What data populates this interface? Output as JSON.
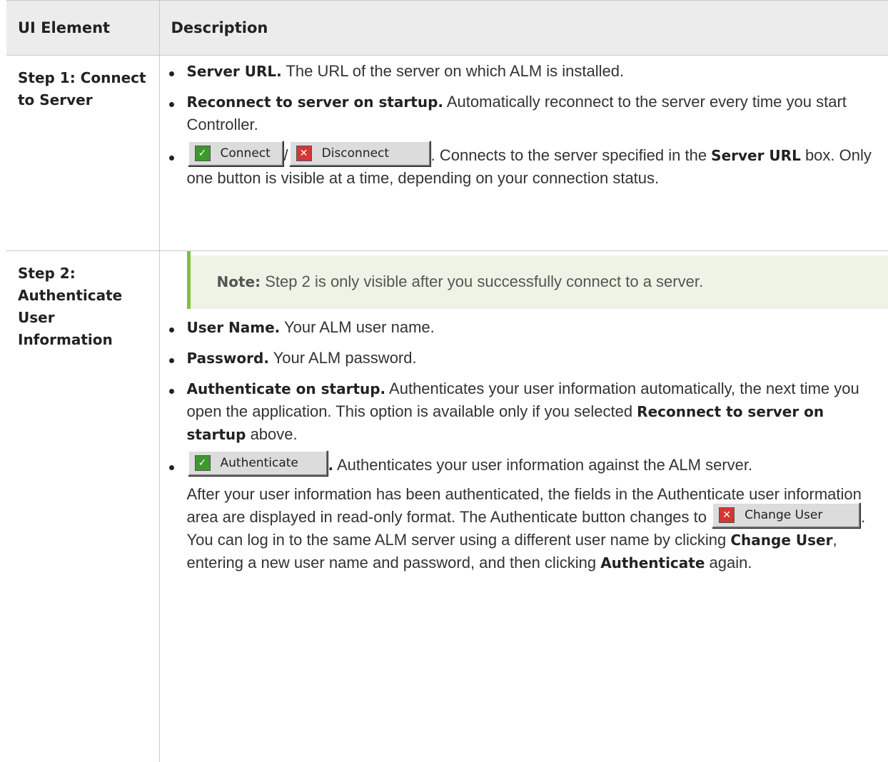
{
  "header": {
    "col1": "UI Element",
    "col2": "Description"
  },
  "step1": {
    "title": "Step 1: Connect to Server",
    "bullet1_label": "Server URL.",
    "bullet1_text": " The URL of the server on which ALM is installed.",
    "bullet2_label": "Reconnect to server on startup.",
    "bullet2_text": " Automatically reconnect to the server every time you start Controller.",
    "connect_button": "Connect",
    "separator": "/",
    "disconnect_button": "Disconnect",
    "bullet3_text_a": ". Connects to the server specified in the ",
    "bullet3_bold": "Server URL",
    "bullet3_text_b": " box. Only one button is visible at a time, depending on your connection status."
  },
  "step2": {
    "title": "Step 2: Authenticate User Information",
    "note_label": "Note:",
    "note_text": " Step 2 is only visible after you successfully connect to a server.",
    "bullet1_label": "User Name.",
    "bullet1_text": " Your ALM user name.",
    "bullet2_label": "Password.",
    "bullet2_text": " Your ALM password.",
    "bullet3_label": "Authenticate on startup.",
    "bullet3_text_a": " Authenticates your user information automatically, the next time you open the application. This option is available only if you selected ",
    "bullet3_bold": "Reconnect to server on startup",
    "bullet3_text_b": " above.",
    "authenticate_button": "Authenticate",
    "bullet4_dot": ".",
    "bullet4_text": " Authenticates your user information against the ALM server.",
    "para1": "After your user information has been authenticated, the fields in the Authenticate user information area are displayed in read-only format. The Authenticate button changes to ",
    "change_user_button": "Change User",
    "para1_end": ".",
    "para2_a": "You can log in to the same ALM server using a different user name by clicking ",
    "para2_bold1": "Change User",
    "para2_b": ", entering a new user name and password, and then clicking ",
    "para2_bold2": "Authenticate",
    "para2_c": " again."
  },
  "colors": {
    "header_bg": "#ececec",
    "note_bg": "#eef3e6",
    "note_accent": "#7dc242",
    "ok_icon": "#3a9a2a",
    "cancel_icon": "#d43636"
  }
}
